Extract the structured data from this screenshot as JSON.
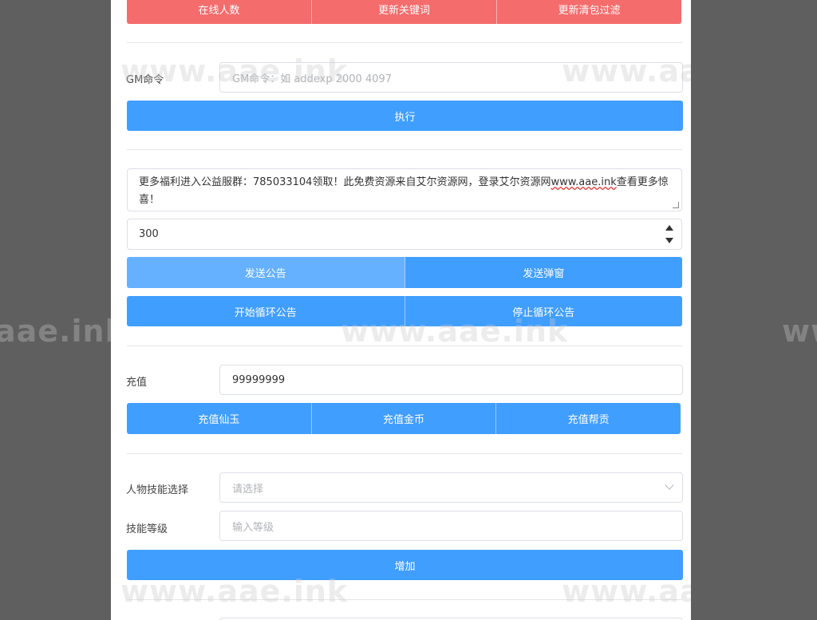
{
  "top_buttons": {
    "online": "在线人数",
    "keywords": "更新关键词",
    "packet_filter": "更新清包过滤"
  },
  "gm": {
    "label": "GM命令",
    "placeholder": "GM命令：如 addexp 2000 4097",
    "execute": "执行"
  },
  "announcement": {
    "text_before": "更多福利进入公益服群：785033104领取！此免费资源来自艾尔资源网，登录艾尔资源网",
    "text_link": "www.aae.ink",
    "text_after": "查看更多惊喜！",
    "interval": "300",
    "send_notice": "发送公告",
    "send_popup": "发送弹窗",
    "start_loop": "开始循环公告",
    "stop_loop": "停止循环公告"
  },
  "recharge": {
    "label": "充值",
    "value": "99999999",
    "jade": "充值仙玉",
    "gold": "充值金币",
    "guild": "充值帮贡"
  },
  "skill": {
    "select_label": "人物技能选择",
    "select_placeholder": "请选择",
    "level_label": "技能等级",
    "level_placeholder": "输入等级",
    "add": "增加"
  },
  "watermark": "www.aae.ink",
  "watermark_short": "aae.ink",
  "watermark_edge": "ww",
  "colors": {
    "primary": "#409eff",
    "primary_light": "#66b1ff",
    "danger": "#f56c6c",
    "backdrop": "#5f5f5f"
  }
}
